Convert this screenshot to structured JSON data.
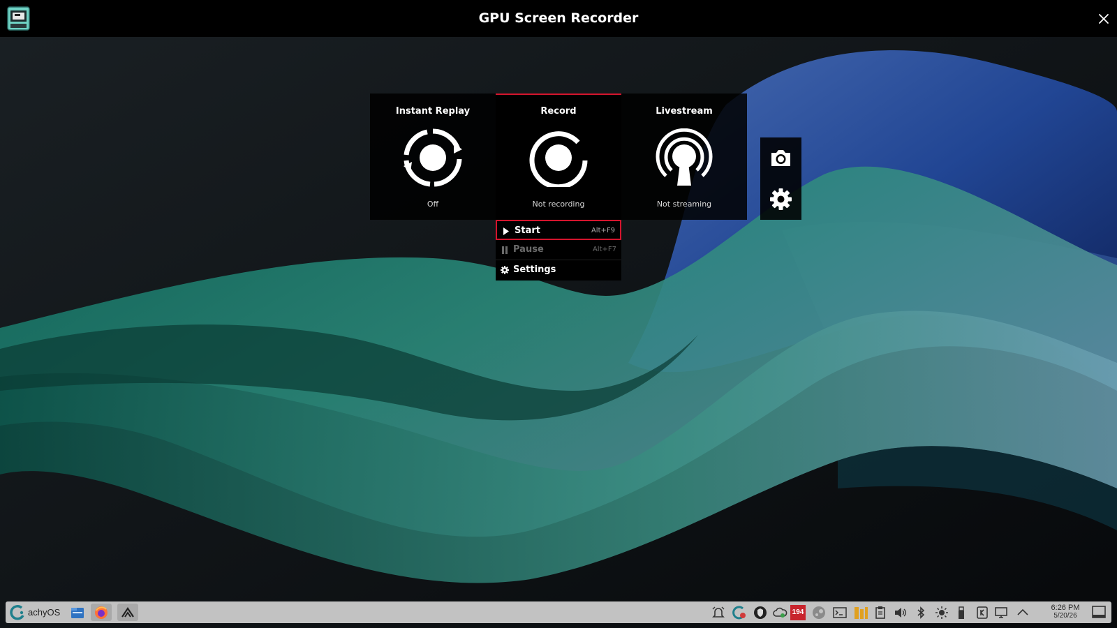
{
  "app": {
    "title": "GPU Screen Recorder"
  },
  "modes": [
    {
      "title": "Instant Replay",
      "status": "Off",
      "icon": "instant-replay-icon"
    },
    {
      "title": "Record",
      "status": "Not recording",
      "icon": "record-icon",
      "active": true
    },
    {
      "title": "Livestream",
      "status": "Not streaming",
      "icon": "livestream-icon"
    }
  ],
  "side_tools": [
    {
      "icon": "camera-icon"
    },
    {
      "icon": "gear-icon"
    }
  ],
  "record_menu": {
    "items": [
      {
        "label": "Start",
        "shortcut": "Alt+F9",
        "icon": "play-icon",
        "selected": true
      },
      {
        "label": "Pause",
        "shortcut": "Alt+F7",
        "icon": "pause-icon",
        "disabled": true
      },
      {
        "label": "Settings",
        "shortcut": "",
        "icon": "gear-icon"
      }
    ]
  },
  "taskbar": {
    "start_label": "achyOS",
    "tray_badge": "194",
    "clock": {
      "time": "6:26 PM",
      "date": "5/20/26"
    }
  },
  "colors": {
    "accent": "#d4142d",
    "panel": "#000000",
    "taskbar": "#c2c2c2"
  }
}
